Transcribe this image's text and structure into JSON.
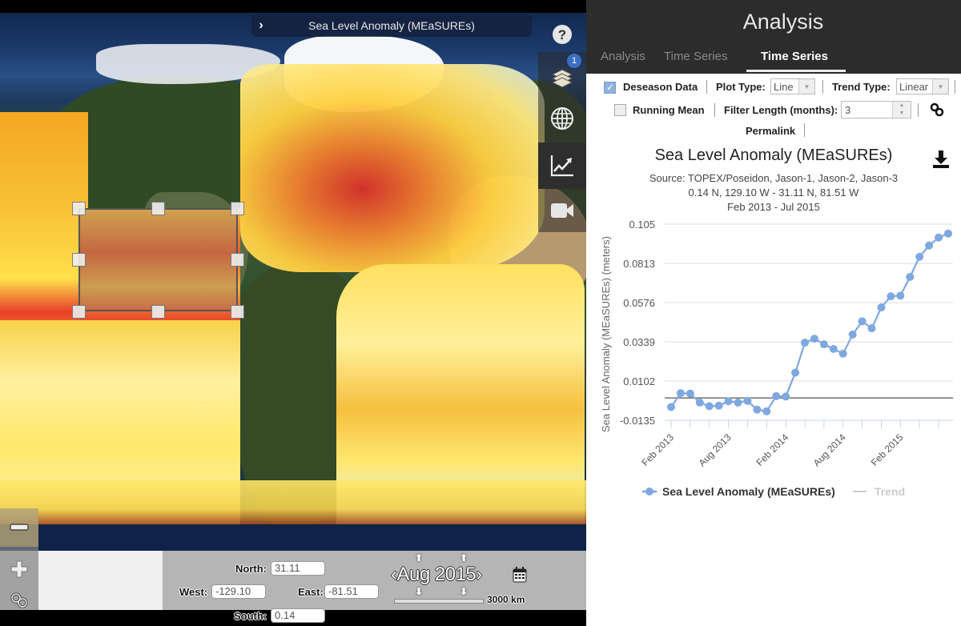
{
  "map": {
    "layer_title": "Sea Level Anomaly (MEaSUREs)",
    "layer_count_badge": "1",
    "icons": [
      "chevron-right-icon",
      "help-icon",
      "layers-icon",
      "globe-icon",
      "chart-icon",
      "video-camera-icon",
      "zoom-out-icon",
      "zoom-in-icon",
      "link-icon",
      "calendar-icon"
    ],
    "coords": {
      "north_label": "North:",
      "north": "31.11",
      "west_label": "West:",
      "west": "-129.10",
      "east_label": "East:",
      "east": "-81.51",
      "south_label": "South:",
      "south": "0.14"
    },
    "date": {
      "month": "Aug",
      "year": "2015",
      "prev": "‹",
      "next": "›"
    },
    "scale_label": "3000 km"
  },
  "panel": {
    "title": "Analysis",
    "tabs": [
      {
        "label": "Analysis",
        "active": false
      },
      {
        "label": "Time Series",
        "active": false
      },
      {
        "label": "Time Series",
        "active": true
      }
    ],
    "controls": {
      "deseason_label": "Deseason Data",
      "deseason_checked": true,
      "plot_type_label": "Plot Type:",
      "plot_type_value": "Line",
      "trend_type_label": "Trend Type:",
      "trend_type_value": "Linear",
      "running_mean_label": "Running Mean",
      "running_mean_checked": false,
      "filter_length_label": "Filter Length (months):",
      "filter_length_value": "3",
      "permalink_label": "Permalink"
    },
    "accent_color": "#7fa8e0"
  },
  "chart_data": {
    "type": "line",
    "title": "Sea Level Anomaly (MEaSUREs)",
    "subtitle_lines": [
      "Source: TOPEX/Poseidon, Jason-1, Jason-2, Jason-3",
      "0.14 N, 129.10 W - 31.11 N, 81.51 W",
      "Feb 2013 - Jul 2015"
    ],
    "xlabel": "",
    "ylabel": "Sea Level Anomaly (MEaSUREs) (meters)",
    "ylim": [
      -0.0135,
      0.105
    ],
    "yticks": [
      "0.105",
      "0.0813",
      "0.0576",
      "0.0339",
      "0.0102",
      "-0.0135"
    ],
    "ytick_values": [
      0.105,
      0.0813,
      0.0576,
      0.0339,
      0.0102,
      -0.0135
    ],
    "xtick_labels": [
      {
        "label": "Feb 2013",
        "index": 0
      },
      {
        "label": "Aug 2013",
        "index": 6
      },
      {
        "label": "Feb 2014",
        "index": 12
      },
      {
        "label": "Aug 2014",
        "index": 18
      },
      {
        "label": "Feb 2015",
        "index": 24
      }
    ],
    "grid": true,
    "legend_position": "bottom",
    "series": [
      {
        "name": "Sea Level Anomaly (MEaSUREs)",
        "color": "#7fa8e0",
        "x": [
          "2013-02",
          "2013-03",
          "2013-04",
          "2013-05",
          "2013-06",
          "2013-07",
          "2013-08",
          "2013-09",
          "2013-10",
          "2013-11",
          "2013-12",
          "2014-01",
          "2014-02",
          "2014-03",
          "2014-04",
          "2014-05",
          "2014-06",
          "2014-07",
          "2014-08",
          "2014-09",
          "2014-10",
          "2014-11",
          "2014-12",
          "2015-01",
          "2015-02",
          "2015-03",
          "2015-04",
          "2015-05",
          "2015-06",
          "2015-07"
        ],
        "values": [
          -0.0055,
          0.0029,
          0.0026,
          -0.0028,
          -0.005,
          -0.0047,
          -0.002,
          -0.0028,
          -0.0018,
          -0.0071,
          -0.0081,
          0.0011,
          0.0008,
          0.0153,
          0.0334,
          0.0358,
          0.0324,
          0.0296,
          0.0267,
          0.0383,
          0.0463,
          0.0421,
          0.0547,
          0.0614,
          0.0618,
          0.0731,
          0.0853,
          0.0921,
          0.0969,
          0.0993
        ]
      },
      {
        "name": "Trend",
        "color": "#555555",
        "legend_color": "#cccccc",
        "values_constant": 0.0
      }
    ]
  }
}
